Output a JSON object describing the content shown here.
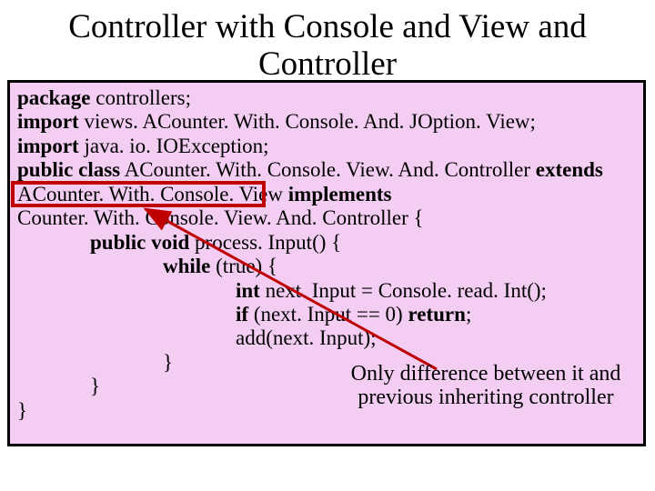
{
  "title": "Controller with Console and View and Controller",
  "code": {
    "l1_kw": "package",
    "l1_rest": " controllers;",
    "l2_kw": "import",
    "l2_rest": " views. ACounter. With. Console. And. JOption. View;",
    "l3_kw": "import",
    "l3_rest": " java. io. IOException;",
    "l4_kw1": "public class",
    "l4_mid": " ACounter. With. Console. View. And. Controller ",
    "l4_kw2": "extends",
    "l5_cls": "ACounter. With. Console. View ",
    "l5_kw": "implements",
    "l6_txt": "Counter. With. Console. View. And. Controller {",
    "l7_kw": "public void",
    "l7_rest": " process. Input() {",
    "l8_kw": "while",
    "l8_rest": " (true) {",
    "l9_kw1": "int",
    "l9_rest": " next. Input = Console. read. Int();",
    "l10_kw1": "if",
    "l10_mid": " (next. Input == 0) ",
    "l10_kw2": "return",
    "l10_end": ";",
    "l11_txt": "add(next. Input);",
    "l12_txt": "}",
    "l13_txt": "}",
    "l14_txt": "}"
  },
  "annotation": "Only difference between it and previous inheriting controller"
}
